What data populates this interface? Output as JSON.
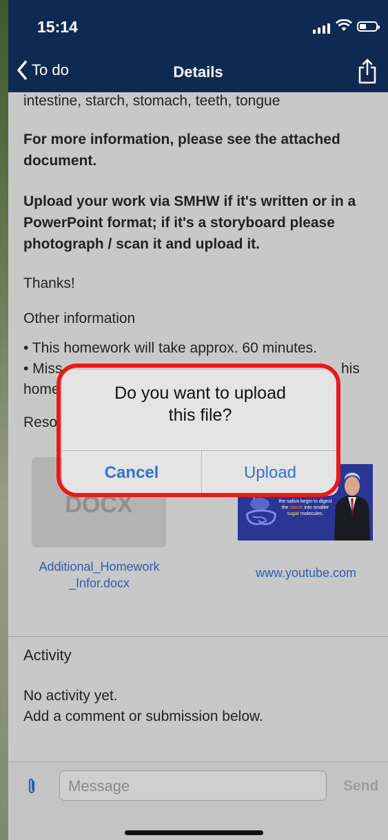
{
  "status_bar": {
    "time": "15:14"
  },
  "nav": {
    "back_label": "To do",
    "title": "Details"
  },
  "content": {
    "topics_line": "intestine, starch, stomach, teeth, tongue",
    "more_info": "For more information, please see the attached document.",
    "upload_instructions": "Upload your work via SMHW if it's written or in a PowerPoint format; if it's a storyboard please photograph / scan it and upload it.",
    "thanks": "Thanks!",
    "other_info_heading": "Other information",
    "bullet_1": "• This homework will take approx. 60 minutes.",
    "bullet_2_left": "• Miss",
    "bullet_2_right": "his",
    "bullet_3_left": "home",
    "resources_heading_partial": "Reso"
  },
  "resources": {
    "file": {
      "ext": "DOCX",
      "name": "Additional_Homework_Infor.docx",
      "name_line1": "Additional_Homework",
      "name_line2": "_Infor.docx"
    },
    "video": {
      "link": "www.youtube.com",
      "thumb_text_1": "the saliva begin to digest",
      "thumb_text_2": "the ",
      "thumb_text_starch": "starch",
      "thumb_text_3": " into smaller",
      "thumb_text_sugar": "sugar",
      "thumb_text_4": " molecules."
    }
  },
  "activity": {
    "heading": "Activity",
    "line1": "No activity yet.",
    "line2": "Add a comment or submission below."
  },
  "composer": {
    "placeholder": "Message",
    "send_label": "Send"
  },
  "alert": {
    "title_line1": "Do you want to upload",
    "title_line2": "this file?",
    "cancel_label": "Cancel",
    "upload_label": "Upload"
  },
  "colors": {
    "nav_bg": "#0f2a52",
    "link": "#2e5ea8",
    "alert_button": "#2f73d4",
    "highlight": "#ec1818"
  }
}
